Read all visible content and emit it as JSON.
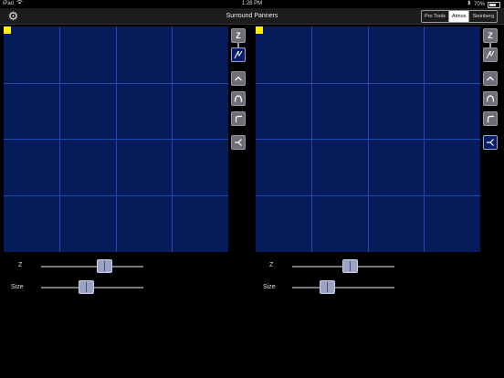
{
  "status": {
    "device": "iPad",
    "time": "1:28 PM",
    "battery": "70%"
  },
  "nav": {
    "title": "Surround Panners",
    "segments": [
      {
        "label": "Pro Tools",
        "active": false
      },
      {
        "label": "Atmos",
        "active": true
      },
      {
        "label": "Steinberg",
        "active": false
      }
    ]
  },
  "panners": [
    {
      "toolbar": {
        "z_label": "Z"
      },
      "sliders": {
        "z_label": "Z",
        "z_value": 0.62,
        "size_label": "Size",
        "size_value": 0.44
      }
    },
    {
      "toolbar": {
        "z_label": "Z"
      },
      "sliders": {
        "z_label": "Z",
        "z_value": 0.57,
        "size_label": "Size",
        "size_value": 0.34
      }
    }
  ],
  "colors": {
    "pad": "#061c5a",
    "grid": "#1e48b2",
    "puck": "#ffee00"
  }
}
